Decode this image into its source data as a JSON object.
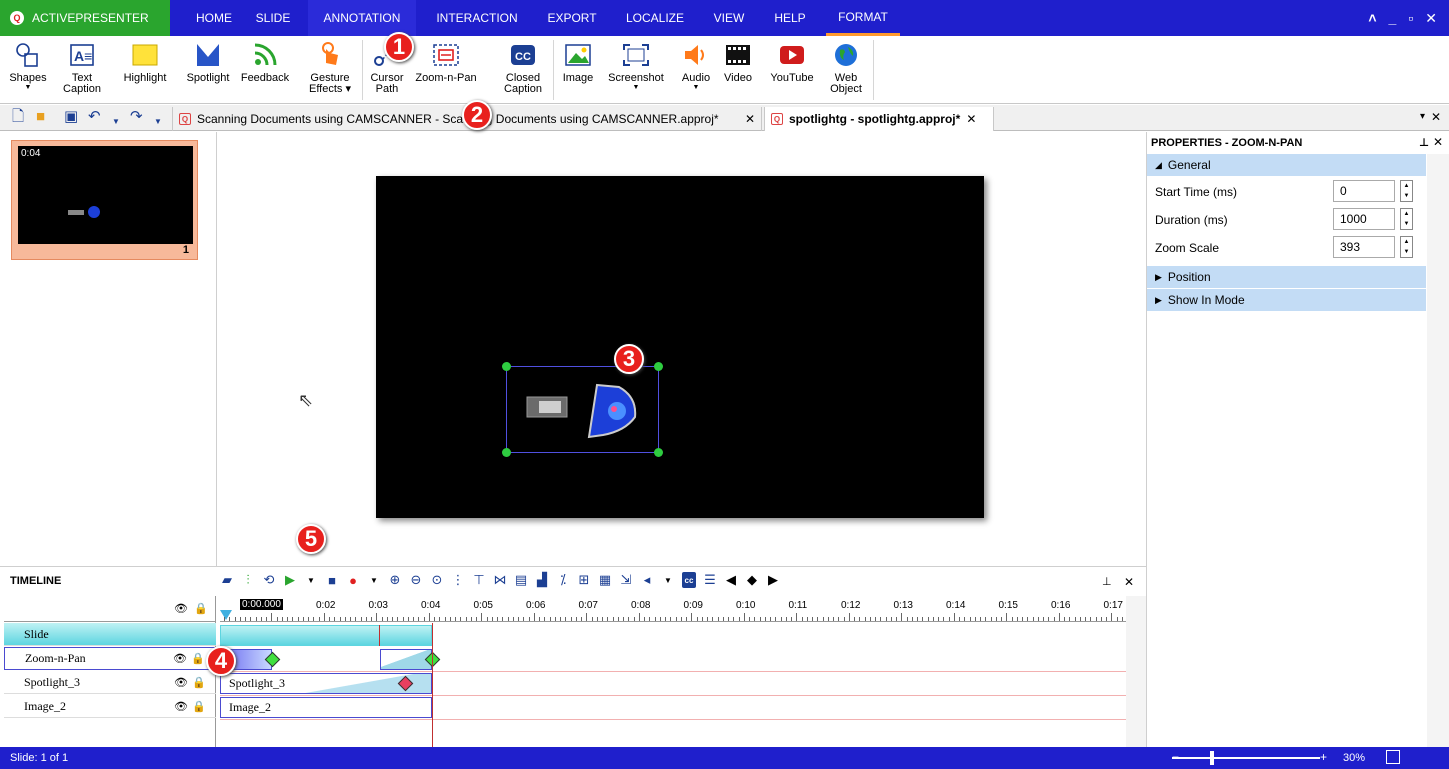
{
  "app": {
    "name": "ACTIVEPRESENTER"
  },
  "menu": [
    {
      "label": "HOME"
    },
    {
      "label": "SLIDE"
    },
    {
      "label": "ANNOTATION"
    },
    {
      "label": "INTERACTION"
    },
    {
      "label": "EXPORT"
    },
    {
      "label": "LOCALIZE"
    },
    {
      "label": "VIEW"
    },
    {
      "label": "HELP"
    },
    {
      "label": "FORMAT"
    }
  ],
  "ribbon": {
    "shapes": "Shapes",
    "text_caption": [
      "Text",
      "Caption"
    ],
    "highlight": "Highlight",
    "spotlight": "Spotlight",
    "feedback": "Feedback",
    "gesture": [
      "Gesture",
      "Effects ▾"
    ],
    "cursor_path": [
      "Cursor",
      "Path"
    ],
    "zoom_n_pan": "Zoom-n-Pan",
    "closed_caption": [
      "Closed",
      "Caption"
    ],
    "image": "Image",
    "screenshot": "Screenshot",
    "audio": "Audio",
    "video": "Video",
    "youtube": "YouTube",
    "web_object": [
      "Web",
      "Object"
    ]
  },
  "tabs": [
    {
      "label": "Scanning Documents using CAMSCANNER - Scanning Documents using CAMSCANNER.approj*"
    },
    {
      "label": "spotlightg - spotlightg.approj*"
    }
  ],
  "slide_thumb": {
    "time": "0:04",
    "number": "1"
  },
  "properties": {
    "title": "PROPERTIES - ZOOM-N-PAN",
    "sections": {
      "general": "General",
      "position": "Position",
      "show_in_mode": "Show In Mode"
    },
    "fields": [
      {
        "label": "Start Time (ms)",
        "value": "0"
      },
      {
        "label": "Duration (ms)",
        "value": "1000"
      },
      {
        "label": "Zoom Scale",
        "value": "393"
      }
    ]
  },
  "timeline": {
    "title": "TIMELINE",
    "playhead": "0:00.000",
    "ticks": [
      "0:02",
      "0:03",
      "0:04",
      "0:05",
      "0:06",
      "0:07",
      "0:08",
      "0:09",
      "0:10",
      "0:11",
      "0:12",
      "0:13",
      "0:14",
      "0:15",
      "0:16",
      "0:17"
    ],
    "tracks": [
      {
        "label": "Slide"
      },
      {
        "label": "Zoom-n-Pan"
      },
      {
        "label": "Spotlight_3"
      },
      {
        "label": "Image_2"
      }
    ],
    "bars": {
      "spotlight": "Spotlight_3",
      "image": "Image_2"
    }
  },
  "status": {
    "slide": "Slide: 1 of 1",
    "zoom": "30%",
    "zoom_level": 0.3
  },
  "callouts": [
    "1",
    "2",
    "3",
    "4",
    "5"
  ],
  "colors": {
    "menubar": "#1f1fcc",
    "app_tab": "#2aa52e",
    "callout": "#e8201d",
    "section": "#c3dcf5"
  }
}
